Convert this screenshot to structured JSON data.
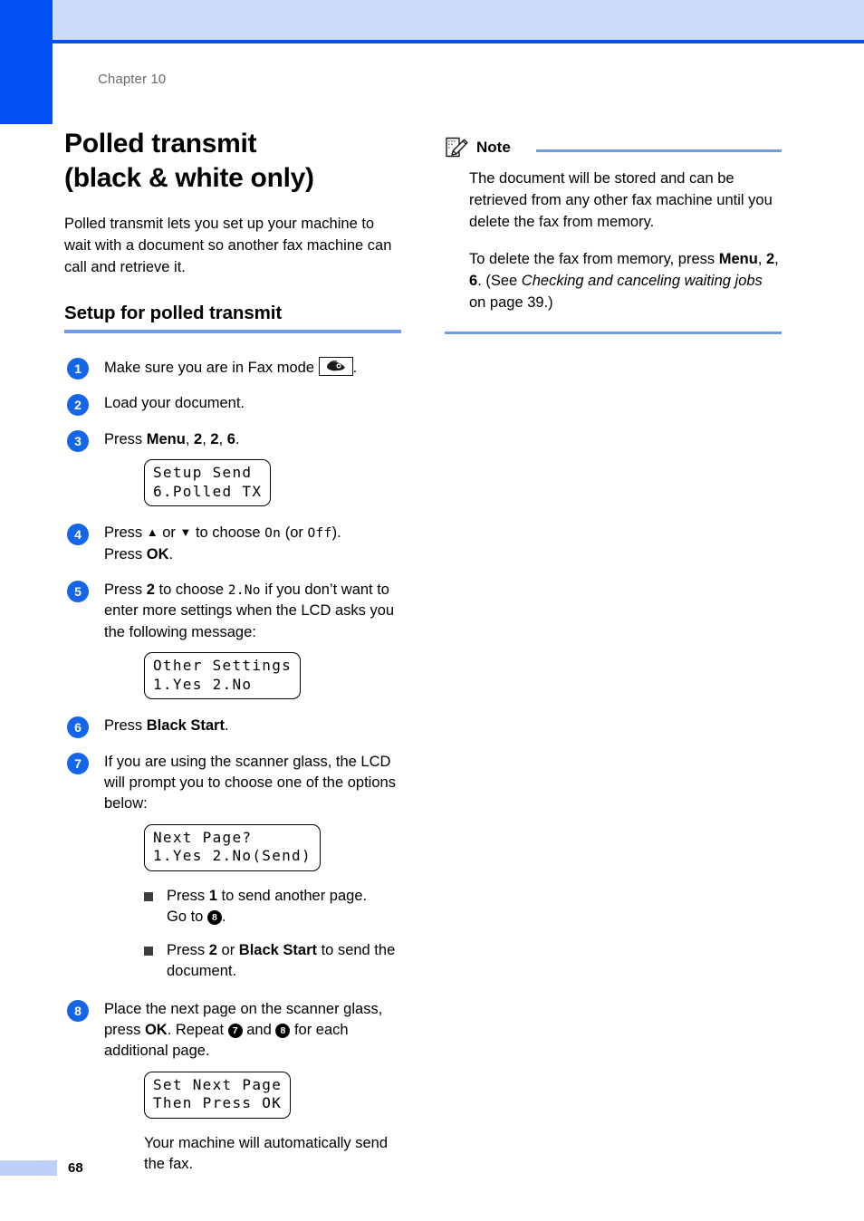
{
  "header": {
    "chapter": "Chapter 10"
  },
  "colors": {
    "tab_blue": "#0350f7",
    "band_blue": "#cddcfa",
    "rule_blue": "#6f9bef",
    "step_circle": "#1565e8",
    "footer_bar": "#bed0f7"
  },
  "left": {
    "title_line1": "Polled transmit",
    "title_line2": "(black & white only)",
    "intro": "Polled transmit lets you set up your machine to wait with a document so another fax machine can call and retrieve it.",
    "section_title": "Setup for polled transmit",
    "steps": [
      {
        "num": "1",
        "text_before": "Make sure you are in Fax mode ",
        "icon": "fax-mode-icon",
        "text_after": "."
      },
      {
        "num": "2",
        "text": "Load your document."
      },
      {
        "num": "3",
        "press": "Press ",
        "b1": "Menu",
        "sep1": ", ",
        "b2": "2",
        "sep2": ", ",
        "b3": "2",
        "sep3": ", ",
        "b4": "6",
        "end": ".",
        "lcd": [
          "Setup Send",
          "6.Polled TX"
        ]
      },
      {
        "num": "4",
        "p1": "Press ",
        "up": "▲",
        "or": " or ",
        "down": "▼",
        "p2": " to choose ",
        "code_on": "On",
        "p3": " (or ",
        "code_off": "Off",
        "p4": ").",
        "line2_pre": "Press ",
        "line2_b": "OK",
        "line2_end": "."
      },
      {
        "num": "5",
        "p1": "Press ",
        "b1": "2",
        "p2": " to choose ",
        "code": "2.No",
        "p3": " if you don’t want to enter more settings when the LCD asks you the following message:",
        "lcd": [
          "Other Settings",
          "1.Yes 2.No"
        ]
      },
      {
        "num": "6",
        "p1": "Press ",
        "b1": "Black Start",
        "p2": "."
      },
      {
        "num": "7",
        "text": "If you are using the scanner glass, the LCD will prompt you to choose one of the options below:",
        "lcd": [
          "Next Page?",
          "1.Yes 2.No(Send)"
        ],
        "bullets": [
          {
            "p1": "Press ",
            "b1": "1",
            "p2": " to send another page.",
            "p3": "Go to ",
            "ref": "8",
            "p4": "."
          },
          {
            "p1": "Press ",
            "b1": "2",
            "p2": " or ",
            "b2": "Black Start",
            "p3": " to send the document."
          }
        ]
      },
      {
        "num": "8",
        "p1": "Place the next page on the scanner glass, press ",
        "b1": "OK",
        "p2": ". Repeat ",
        "ref1": "7",
        "p3": " and ",
        "ref2": "8",
        "p4": " for each additional page.",
        "lcd": [
          "Set Next Page",
          "Then Press OK"
        ],
        "trailing": "Your machine will automatically send the fax."
      }
    ]
  },
  "right": {
    "note": {
      "icon": "note-pencil-icon",
      "label": "Note",
      "paragraph1": "The document will be stored and can be retrieved from any other fax machine until you delete the fax from memory.",
      "p2_pre": "To delete the fax from memory, press ",
      "p2_b1": "Menu",
      "p2_sep1": ", ",
      "p2_b2": "2",
      "p2_sep2": ", ",
      "p2_b3": "6",
      "p2_mid": ". (See ",
      "p2_italic": "Checking and canceling waiting jobs",
      "p2_end": " on page 39.)"
    }
  },
  "footer": {
    "page_number": "68"
  }
}
